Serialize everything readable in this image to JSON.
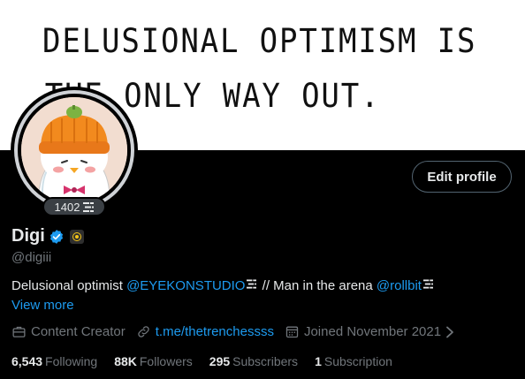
{
  "banner": {
    "line1": "DELUSIONAL OPTIMISM IS",
    "line2": "THE ONLY WAY OUT."
  },
  "avatar": {
    "icon": "penguin-avatar"
  },
  "level_badge": {
    "value": "1402",
    "icon": "stack-icon"
  },
  "edit_profile_label": "Edit profile",
  "profile": {
    "display_name": "Digi",
    "handle": "@digiii",
    "verified_color": "#1d9bf0"
  },
  "bio": {
    "part1": "Delusional optimist ",
    "mention1": "@EYEKONSTUDIO",
    "part2": " // Man in the arena ",
    "mention2": "@rollbit",
    "view_more": "View more"
  },
  "meta": {
    "category": "Content Creator",
    "link": "t.me/thetrenchessss",
    "joined": "Joined November 2021"
  },
  "stats": {
    "following_count": "6,543",
    "following_label": "Following",
    "followers_count": "88K",
    "followers_label": "Followers",
    "subscribers_count": "295",
    "subscribers_label": "Subscribers",
    "subscription_count": "1",
    "subscription_label": "Subscription"
  },
  "colors": {
    "accent": "#1d9bf0",
    "muted": "#71767b",
    "text": "#e7e9ea",
    "background": "#000000"
  }
}
